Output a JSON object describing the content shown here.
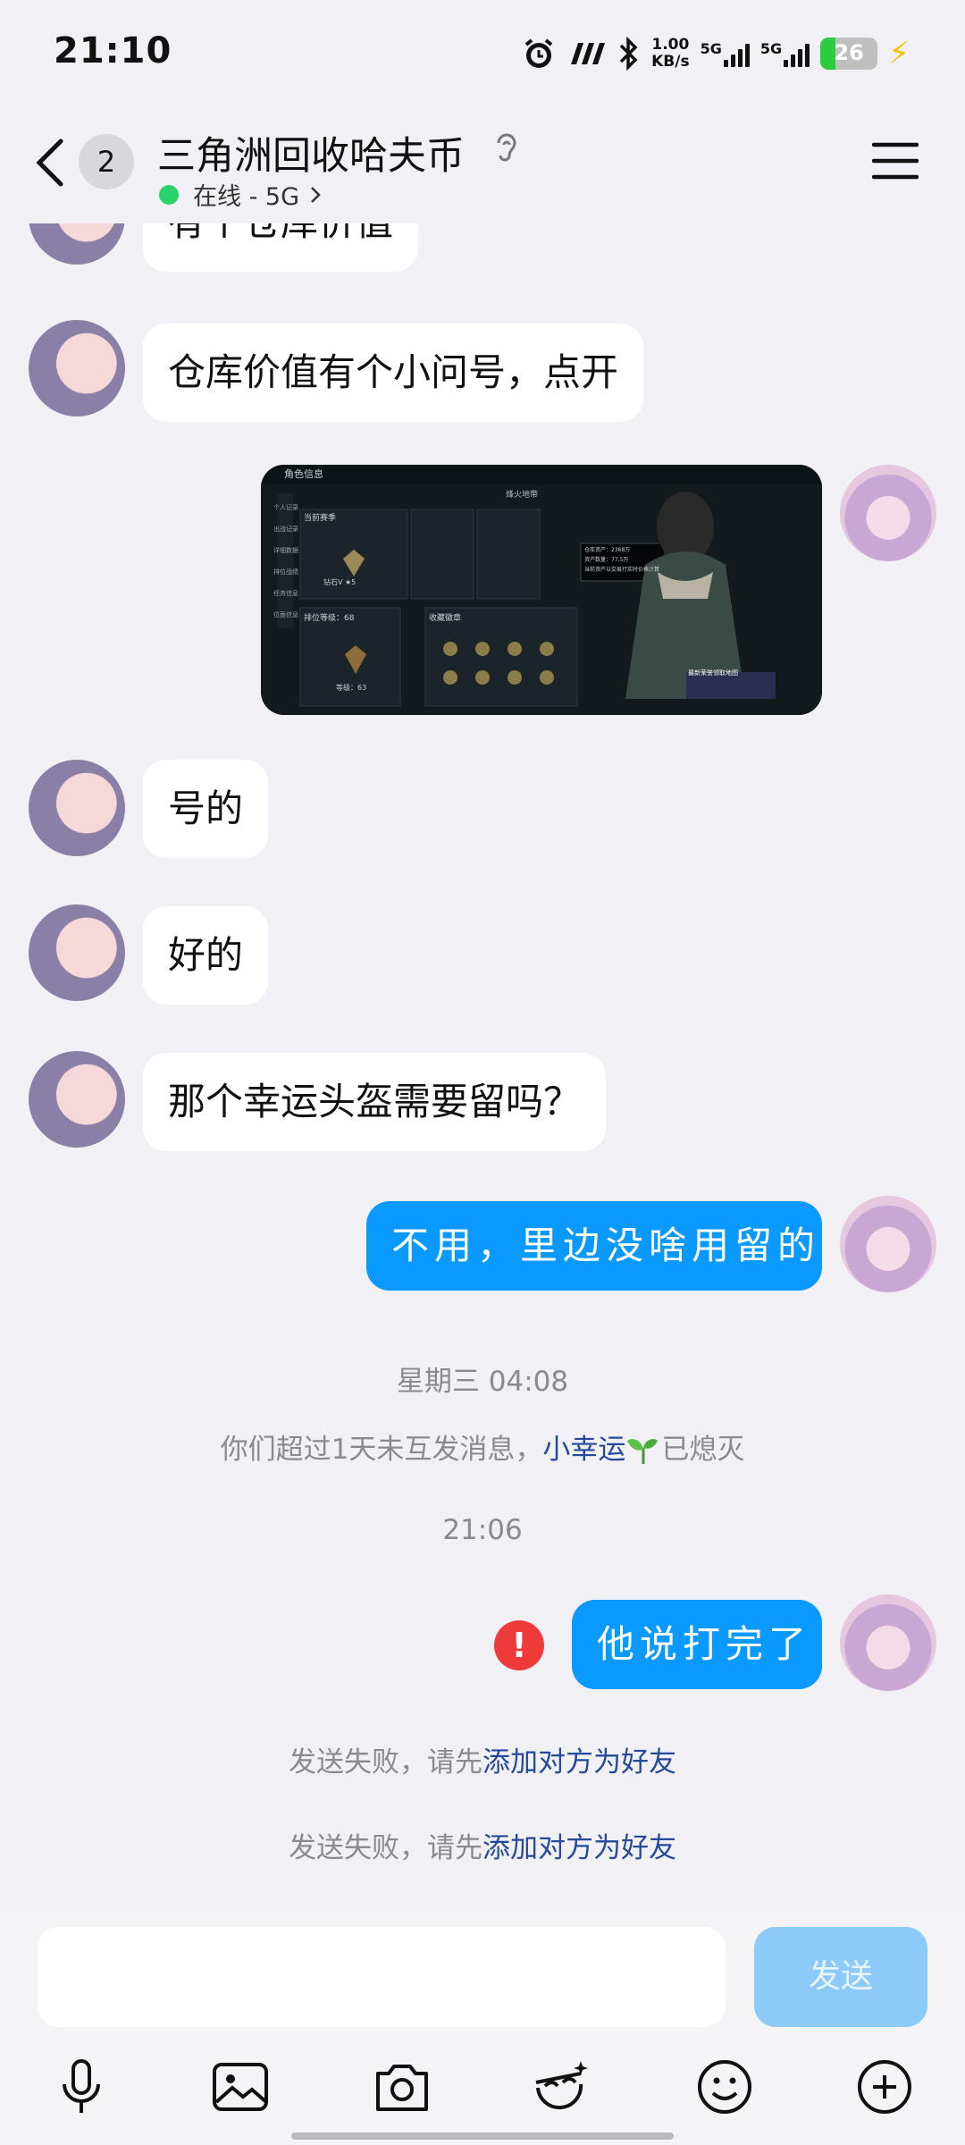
{
  "status_bar": {
    "time": "21:10",
    "net_speed_value": "1.00",
    "net_speed_unit": "KB/s",
    "sim1_label": "5G",
    "sim2_label": "5G",
    "battery_level": "26",
    "battery_fraction": 0.26,
    "icons": [
      "alarm-icon",
      "hd-icon",
      "bluetooth-icon",
      "signal-icon",
      "signal-icon",
      "battery-icon",
      "charging-icon"
    ]
  },
  "header": {
    "unread_count": "2",
    "title": "三角洲回收哈夫币",
    "status": "在线 - 5G",
    "status_color": "#2bd46a",
    "icons": [
      "back-icon",
      "ear-icon",
      "chevron-right-icon",
      "menu-icon"
    ]
  },
  "messages": [
    {
      "side": "other",
      "text": "有个仓库价值"
    },
    {
      "side": "other",
      "text": "仓库价值有个小问号，点开"
    },
    {
      "side": "me",
      "type": "image"
    },
    {
      "side": "other",
      "text": "号的"
    },
    {
      "side": "other",
      "text": "好的"
    },
    {
      "side": "other",
      "text": "那个幸运头盔需要留吗？"
    },
    {
      "side": "me",
      "text": "不用，里边没啥用留的"
    },
    {
      "side": "me",
      "text": "他说打完了",
      "failed": true
    }
  ],
  "screenshot_image": {
    "header": "角色信息",
    "tab": "烽火地带",
    "sidebar": [
      "个人记录",
      "出战记录",
      "详细数据",
      "排位战绩",
      "任务信息",
      "位面信息"
    ],
    "section_season": "当前赛季",
    "section_rank": "排位等级：68",
    "section_badges": "收藏徽章",
    "rank_label": "钻石V ★5",
    "level_label": "等级：63",
    "tooltip_lines": [
      "仓库资产：2368万",
      "资产数量：77.5万",
      "当前资产以交易行实时价格计算"
    ],
    "banner": "最新荣誉领取地图"
  },
  "system": {
    "time_1": "星期三 04:08",
    "spark_notice_prefix": "你们超过1天未互发消息，",
    "spark_notice_link": "小幸运",
    "spark_notice_suffix": "已熄灭",
    "time_2": "21:06",
    "fail_prefix": "发送失败，请先",
    "fail_link": "添加对方为好友",
    "error_symbol": "!"
  },
  "composer": {
    "placeholder": "",
    "send_label": "发送",
    "tools": [
      "microphone-icon",
      "image-icon",
      "camera-icon",
      "sticker-icon",
      "emoji-icon",
      "plus-icon"
    ]
  },
  "colors": {
    "bubble_me": "#0a99ff",
    "bubble_other": "#ffffff",
    "link": "#254a9a",
    "error": "#ef3a3a",
    "send_disabled": "#8ccaf9"
  }
}
